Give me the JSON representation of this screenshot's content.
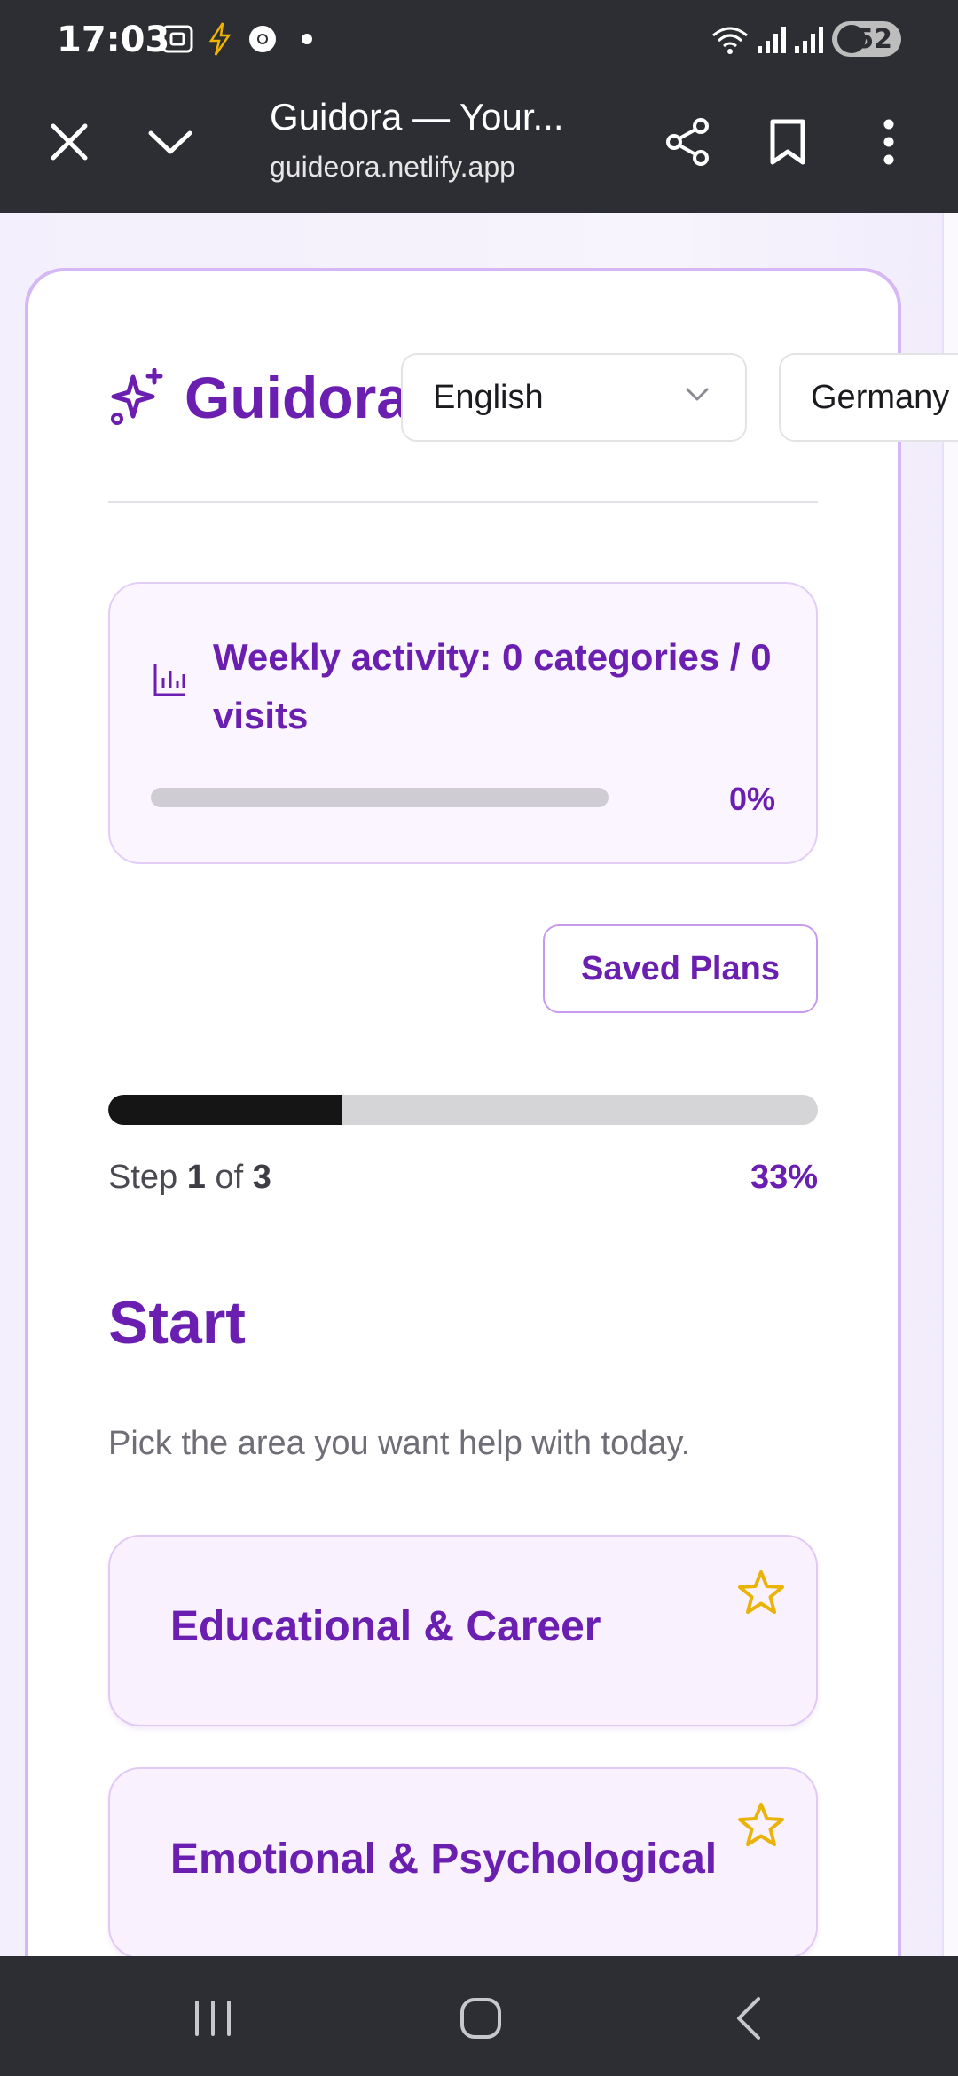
{
  "status_bar": {
    "time": "17:03",
    "battery": "52",
    "icons": [
      "screenshot-icon",
      "flash-icon",
      "chrome-icon",
      "dot-icon",
      "wifi-icon",
      "signal-icon",
      "signal-icon",
      "battery-icon"
    ]
  },
  "browser": {
    "title": "Guidora — Your...",
    "url": "guideora.netlify.app",
    "icons": [
      "close-icon",
      "chevron-down-icon",
      "share-icon",
      "bookmark-icon",
      "more-vert-icon"
    ]
  },
  "header": {
    "logo_text": "Guidora",
    "logo_icon": "sparkles-icon",
    "language_select": "English",
    "country_select": "Germany"
  },
  "activity": {
    "title": "Weekly activity: 0 categories / 0 visits",
    "icon": "bar-chart-icon",
    "progress": 0,
    "percent_label": "0%",
    "colors": {
      "accent": "#6a1fb0",
      "track": "#cfcdd3"
    }
  },
  "saved_plans_label": "Saved Plans",
  "steps": {
    "word_step": "Step",
    "current": "1",
    "word_of": "of",
    "total": "3",
    "progress": 0.33,
    "percent_label": "33%"
  },
  "section": {
    "title": "Start",
    "subtitle": "Pick the area you want help with today."
  },
  "categories": [
    {
      "label": "Educational & Career",
      "icon": "star-outline-icon"
    },
    {
      "label": "Emotional & Psychological",
      "icon": "star-outline-icon"
    }
  ],
  "navbar": {
    "icons": [
      "recents-icon",
      "home-icon",
      "back-icon"
    ]
  }
}
